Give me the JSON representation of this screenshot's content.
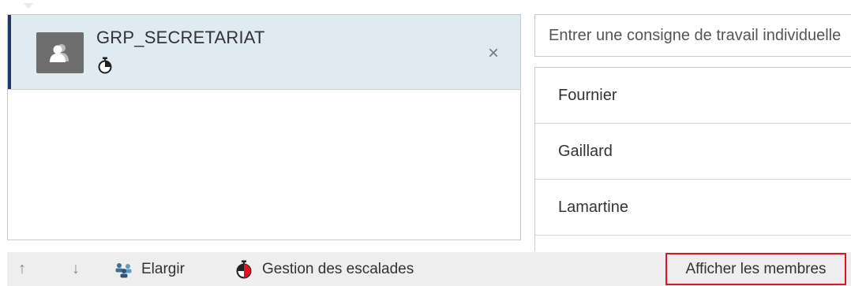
{
  "assignee": {
    "name": "GRP_SECRETARIAT",
    "remove_symbol": "×"
  },
  "instruction": {
    "placeholder": "Entrer une consigne de travail individuelle"
  },
  "members": [
    {
      "label": "Fournier"
    },
    {
      "label": "Gaillard"
    },
    {
      "label": "Lamartine"
    }
  ],
  "toolbar": {
    "move_up": "↑",
    "move_down": "↓",
    "expand_label": "Elargir",
    "escalation_label": "Gestion des escalades",
    "show_members_label": "Afficher les membres"
  },
  "colors": {
    "selected_row_bg": "#dfeaf1",
    "selected_row_accent": "#1f3a5c",
    "highlight_border": "#e0141e",
    "toolbar_bg": "#eeeeee"
  }
}
